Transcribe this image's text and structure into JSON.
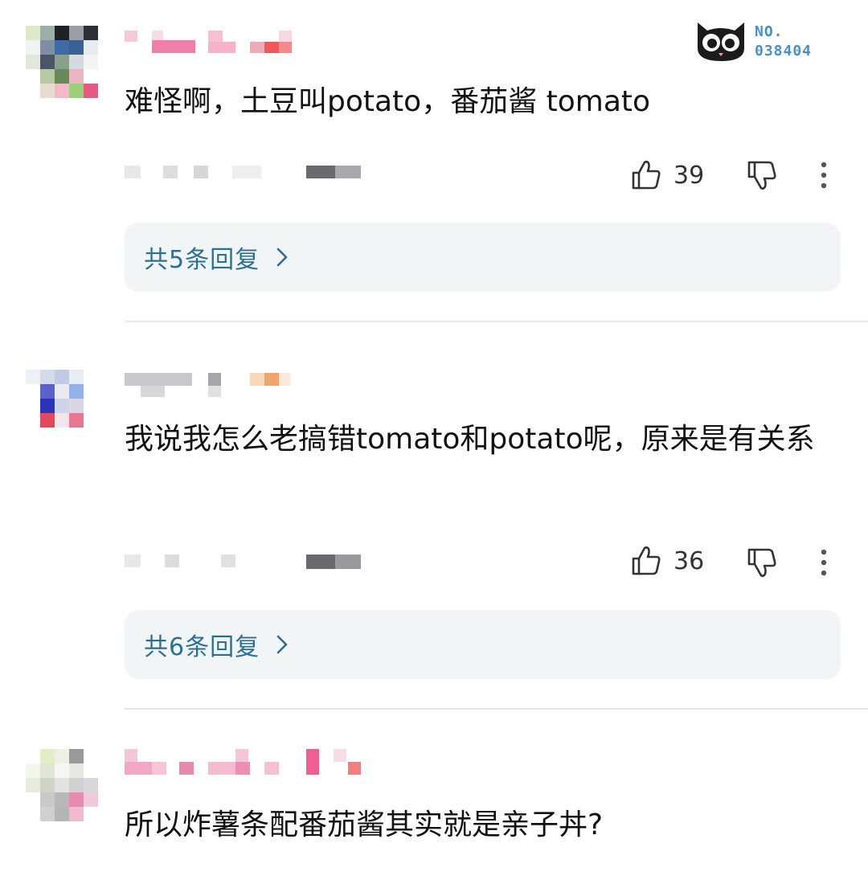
{
  "watermark": {
    "line1": "NO.",
    "line2": "038404",
    "logo_icon": "cat-face-icon"
  },
  "comments": [
    {
      "text": "难怪啊，土豆叫potato，番茄酱 tomato",
      "likes": "39",
      "replies": "共5条回复"
    },
    {
      "text": "我说我怎么老搞错tomato和potato呢，原来是有关系",
      "likes": "36",
      "replies": "共6条回复"
    },
    {
      "text": "所以炸薯条配番茄酱其实就是亲子丼?"
    }
  ],
  "icons": {
    "like": "thumbs-up-icon",
    "dislike": "thumbs-down-icon",
    "more": "more-vertical-icon",
    "chevron": "chevron-right-icon"
  },
  "colors": {
    "reply_link": "#2c6f95",
    "reply_bg": "#f2f5f6",
    "divider": "#e8e8e8"
  }
}
